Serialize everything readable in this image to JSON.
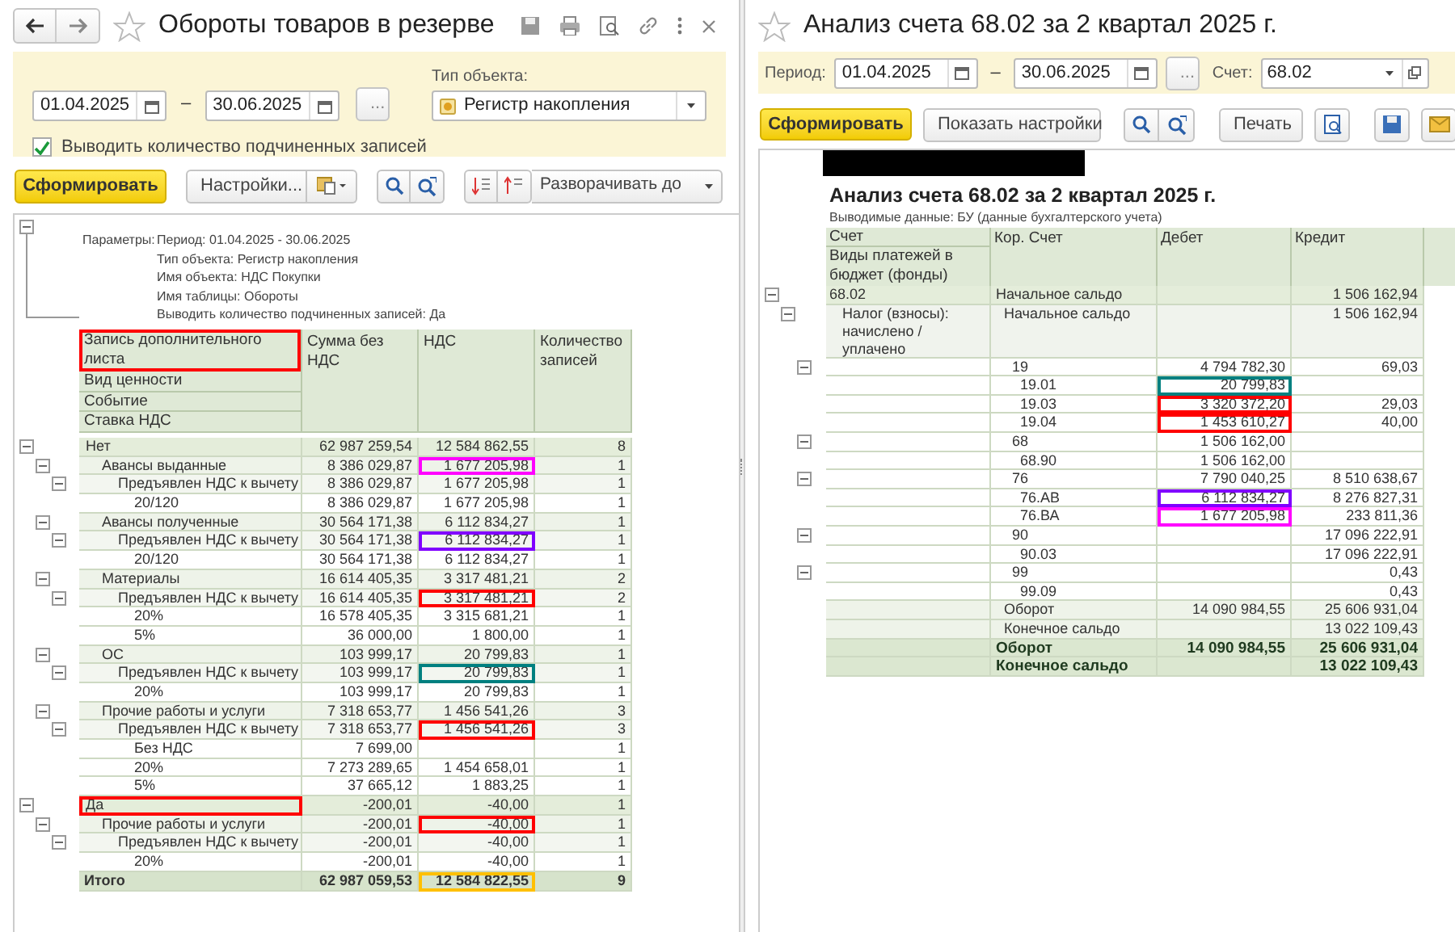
{
  "left": {
    "title": "Обороты товаров в резерве",
    "filters": {
      "date_from": "01.04.2025",
      "separator": "–",
      "date_to": "30.06.2025",
      "more": "...",
      "object_type_label": "Тип объекта:",
      "object_type": "Регистр накопления",
      "show_count": {
        "label": "Выводить количество подчиненных записей",
        "checked": true
      }
    },
    "toolbar": {
      "generate": "Сформировать",
      "settings": "Настройки...",
      "expand": "Разворачивать до"
    },
    "parameters": {
      "label": "Параметры:",
      "lines": [
        "Период: 01.04.2025 - 30.06.2025",
        "Тип объекта: Регистр накопления",
        "Имя объекта: НДС Покупки",
        "Имя таблицы: Обороты",
        "Выводить количество подчиненных записей: Да"
      ]
    },
    "header": {
      "grouping": [
        {
          "label": "Запись дополнительного листа",
          "outline": {
            "color": "#ff0000"
          }
        },
        {
          "label": "Вид ценности"
        },
        {
          "label": "Событие"
        },
        {
          "label": "Ставка НДС"
        }
      ],
      "columns": [
        "Сумма без НДС",
        "НДС",
        "Количество записей"
      ]
    },
    "rows": [
      {
        "label": "Нет",
        "sum": "62 987 259,54",
        "vat": "12 584 862,55",
        "count": "8",
        "children": [
          {
            "label": "Авансы выданные",
            "sum": "8 386 029,87",
            "vat": "1 677 205,98",
            "count": "1",
            "outline_vat": {
              "color": "#ff00ff"
            },
            "children": [
              {
                "label": "Предъявлен НДС к вычету",
                "sum": "8 386 029,87",
                "vat": "1 677 205,98",
                "count": "1",
                "children": [
                  {
                    "label": "20/120",
                    "sum": "8 386 029,87",
                    "vat": "1 677 205,98",
                    "count": "1"
                  }
                ]
              }
            ]
          },
          {
            "label": "Авансы полученные",
            "sum": "30 564 171,38",
            "vat": "6 112 834,27",
            "count": "1",
            "children": [
              {
                "label": "Предъявлен НДС к вычету",
                "sum": "30 564 171,38",
                "vat": "6 112 834,27",
                "count": "1",
                "outline_vat": {
                  "color": "#8000ff"
                },
                "children": [
                  {
                    "label": "20/120",
                    "sum": "30 564 171,38",
                    "vat": "6 112 834,27",
                    "count": "1"
                  }
                ]
              }
            ]
          },
          {
            "label": "Материалы",
            "sum": "16 614 405,35",
            "vat": "3 317 481,21",
            "count": "2",
            "children": [
              {
                "label": "Предъявлен НДС к вычету",
                "sum": "16 614 405,35",
                "vat": "3 317 481,21",
                "count": "2",
                "outline_vat": {
                  "color": "#ff0000"
                },
                "children": [
                  {
                    "label": "20%",
                    "sum": "16 578 405,35",
                    "vat": "3 315 681,21",
                    "count": "1"
                  },
                  {
                    "label": "5%",
                    "sum": "36 000,00",
                    "vat": "1 800,00",
                    "count": "1"
                  }
                ]
              }
            ]
          },
          {
            "label": "ОС",
            "sum": "103 999,17",
            "vat": "20 799,83",
            "count": "1",
            "children": [
              {
                "label": "Предъявлен НДС к вычету",
                "sum": "103 999,17",
                "vat": "20 799,83",
                "count": "1",
                "outline_vat": {
                  "color": "#008080"
                },
                "children": [
                  {
                    "label": "20%",
                    "sum": "103 999,17",
                    "vat": "20 799,83",
                    "count": "1"
                  }
                ]
              }
            ]
          },
          {
            "label": "Прочие работы и услуги",
            "sum": "7 318 653,77",
            "vat": "1 456 541,26",
            "count": "3",
            "children": [
              {
                "label": "Предъявлен НДС к вычету",
                "sum": "7 318 653,77",
                "vat": "1 456 541,26",
                "count": "3",
                "outline_vat": {
                  "color": "#ff0000"
                },
                "children": [
                  {
                    "label": "Без НДС",
                    "sum": "7 699,00",
                    "count": "1"
                  },
                  {
                    "label": "20%",
                    "sum": "7 273 289,65",
                    "vat": "1 454 658,01",
                    "count": "1"
                  },
                  {
                    "label": "5%",
                    "sum": "37 665,12",
                    "vat": "1 883,25",
                    "count": "1"
                  }
                ]
              }
            ]
          }
        ]
      },
      {
        "label": "Да",
        "sum": "-200,01",
        "vat": "-40,00",
        "count": "1",
        "outline_label": {
          "color": "#ff0000"
        },
        "children": [
          {
            "label": "Прочие работы и услуги",
            "sum": "-200,01",
            "vat": "-40,00",
            "count": "1",
            "outline_vat": {
              "color": "#ff0000"
            },
            "children": [
              {
                "label": "Предъявлен НДС к вычету",
                "sum": "-200,01",
                "vat": "-40,00",
                "count": "1",
                "children": [
                  {
                    "label": "20%",
                    "sum": "-200,01",
                    "vat": "-40,00",
                    "count": "1"
                  }
                ]
              }
            ]
          }
        ]
      }
    ],
    "total": {
      "label": "Итого",
      "sum": "62 987 059,53",
      "vat": "12 584 822,55",
      "count": "9",
      "outline_vat": {
        "color": "#ffc000"
      }
    }
  },
  "right": {
    "title": "Анализ счета 68.02 за 2 квартал 2025 г.",
    "filters": {
      "period_label": "Период:",
      "date_from": "01.04.2025",
      "separator": "–",
      "date_to": "30.06.2025",
      "more": "...",
      "account_label": "Счет:",
      "account": "68.02"
    },
    "toolbar": {
      "generate": "Сформировать",
      "show_settings": "Показать настройки",
      "print": "Печать"
    },
    "report_title": "Анализ счета 68.02 за 2 квартал 2025 г.",
    "report_subtitle": "Выводимые данные: БУ (данные бухгалтерского учета)",
    "header": {
      "account": [
        "Счет",
        "Виды платежей в бюджет (фонды)"
      ],
      "kor": "Кор. Счет",
      "debit": "Дебет",
      "credit": "Кредит"
    },
    "rows": [
      {
        "account": "68.02",
        "kor": "Начальное сальдо",
        "credit": "1 506 162,94",
        "children": [
          {
            "account": "Налог (взносы): начислено / уплачено",
            "kor": "Начальное сальдо",
            "credit": "1 506 162,94",
            "children": [
              {
                "kind": "account",
                "kor": "19",
                "debit": "4 794 782,30",
                "credit": "69,03",
                "children": [
                  {
                    "kind": "account",
                    "kor": "19.01",
                    "debit": "20 799,83",
                    "outline_debit": {
                      "color": "#008080"
                    }
                  },
                  {
                    "kind": "account",
                    "kor": "19.03",
                    "debit": "3 320 372,20",
                    "credit": "29,03",
                    "outline_debit": {
                      "color": "#ff0000"
                    }
                  },
                  {
                    "kind": "account",
                    "kor": "19.04",
                    "debit": "1 453 610,27",
                    "credit": "40,00",
                    "outline_debit": {
                      "color": "#ff0000"
                    }
                  }
                ]
              },
              {
                "kind": "account",
                "kor": "68",
                "debit": "1 506 162,00",
                "children": [
                  {
                    "kind": "account",
                    "kor": "68.90",
                    "debit": "1 506 162,00"
                  }
                ]
              },
              {
                "kind": "account",
                "kor": "76",
                "debit": "7 790 040,25",
                "credit": "8 510 638,67",
                "children": [
                  {
                    "kind": "account",
                    "kor": "76.АВ",
                    "debit": "6 112 834,27",
                    "credit": "8 276 827,31",
                    "outline_debit": {
                      "color": "#8000ff"
                    }
                  },
                  {
                    "kind": "account",
                    "kor": "76.ВА",
                    "debit": "1 677 205,98",
                    "credit": "233 811,36",
                    "outline_debit": {
                      "color": "#ff00ff"
                    }
                  }
                ]
              },
              {
                "kind": "account",
                "kor": "90",
                "credit": "17 096 222,91",
                "children": [
                  {
                    "kind": "account",
                    "kor": "90.03",
                    "credit": "17 096 222,91"
                  }
                ]
              },
              {
                "kind": "account",
                "kor": "99",
                "credit": "0,43",
                "children": [
                  {
                    "kind": "account",
                    "kor": "99.09",
                    "credit": "0,43"
                  }
                ]
              },
              {
                "kind": "summary",
                "kor": "Оборот",
                "debit": "14 090 984,55",
                "credit": "25 606 931,04"
              },
              {
                "kind": "summary",
                "kor": "Конечное сальдо",
                "credit": "13 022 109,43"
              }
            ]
          }
        ]
      }
    ],
    "totals": [
      {
        "label": "Оборот",
        "debit": "14 090 984,55",
        "credit": "25 606 931,04"
      },
      {
        "label": "Конечное сальдо",
        "credit": "13 022 109,43"
      }
    ]
  }
}
